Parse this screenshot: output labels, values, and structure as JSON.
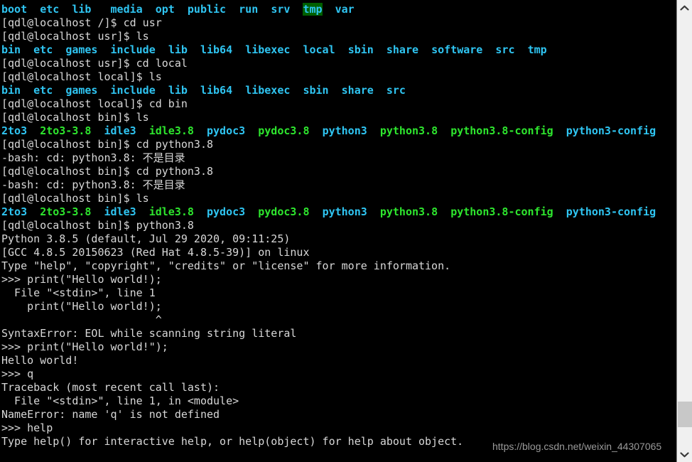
{
  "terminal": {
    "prompt_user_host": "[qdl@localhost",
    "lines": [
      {
        "id": "ls-root-output",
        "segments": [
          {
            "text": "boot",
            "style": "dir"
          },
          {
            "text": "  ",
            "style": "default"
          },
          {
            "text": "etc",
            "style": "dir"
          },
          {
            "text": "  ",
            "style": "default"
          },
          {
            "text": "lib",
            "style": "dir"
          },
          {
            "text": "   ",
            "style": "default"
          },
          {
            "text": "media",
            "style": "dir"
          },
          {
            "text": "  ",
            "style": "default"
          },
          {
            "text": "opt",
            "style": "dir"
          },
          {
            "text": "  ",
            "style": "default"
          },
          {
            "text": "public",
            "style": "dir"
          },
          {
            "text": "  ",
            "style": "default"
          },
          {
            "text": "run",
            "style": "dir"
          },
          {
            "text": "  ",
            "style": "default"
          },
          {
            "text": "srv",
            "style": "dir"
          },
          {
            "text": "  ",
            "style": "default"
          },
          {
            "text": "tmp",
            "style": "dir-sticky"
          },
          {
            "text": "  ",
            "style": "default"
          },
          {
            "text": "var",
            "style": "dir"
          }
        ]
      },
      {
        "id": "prompt-cd-usr",
        "segments": [
          {
            "text": "[qdl@localhost /]$ cd usr",
            "style": "default"
          }
        ]
      },
      {
        "id": "prompt-ls-usr",
        "segments": [
          {
            "text": "[qdl@localhost usr]$ ls",
            "style": "default"
          }
        ]
      },
      {
        "id": "ls-usr-output",
        "segments": [
          {
            "text": "bin",
            "style": "dir"
          },
          {
            "text": "  ",
            "style": "default"
          },
          {
            "text": "etc",
            "style": "dir"
          },
          {
            "text": "  ",
            "style": "default"
          },
          {
            "text": "games",
            "style": "dir"
          },
          {
            "text": "  ",
            "style": "default"
          },
          {
            "text": "include",
            "style": "dir"
          },
          {
            "text": "  ",
            "style": "default"
          },
          {
            "text": "lib",
            "style": "dir"
          },
          {
            "text": "  ",
            "style": "default"
          },
          {
            "text": "lib64",
            "style": "dir"
          },
          {
            "text": "  ",
            "style": "default"
          },
          {
            "text": "libexec",
            "style": "dir"
          },
          {
            "text": "  ",
            "style": "default"
          },
          {
            "text": "local",
            "style": "dir"
          },
          {
            "text": "  ",
            "style": "default"
          },
          {
            "text": "sbin",
            "style": "dir"
          },
          {
            "text": "  ",
            "style": "default"
          },
          {
            "text": "share",
            "style": "dir"
          },
          {
            "text": "  ",
            "style": "default"
          },
          {
            "text": "software",
            "style": "dir"
          },
          {
            "text": "  ",
            "style": "default"
          },
          {
            "text": "src",
            "style": "dir"
          },
          {
            "text": "  ",
            "style": "default"
          },
          {
            "text": "tmp",
            "style": "dir"
          }
        ]
      },
      {
        "id": "prompt-cd-local",
        "segments": [
          {
            "text": "[qdl@localhost usr]$ cd local",
            "style": "default"
          }
        ]
      },
      {
        "id": "prompt-ls-local",
        "segments": [
          {
            "text": "[qdl@localhost local]$ ls",
            "style": "default"
          }
        ]
      },
      {
        "id": "ls-local-output",
        "segments": [
          {
            "text": "bin",
            "style": "dir"
          },
          {
            "text": "  ",
            "style": "default"
          },
          {
            "text": "etc",
            "style": "dir"
          },
          {
            "text": "  ",
            "style": "default"
          },
          {
            "text": "games",
            "style": "dir"
          },
          {
            "text": "  ",
            "style": "default"
          },
          {
            "text": "include",
            "style": "dir"
          },
          {
            "text": "  ",
            "style": "default"
          },
          {
            "text": "lib",
            "style": "dir"
          },
          {
            "text": "  ",
            "style": "default"
          },
          {
            "text": "lib64",
            "style": "dir"
          },
          {
            "text": "  ",
            "style": "default"
          },
          {
            "text": "libexec",
            "style": "dir"
          },
          {
            "text": "  ",
            "style": "default"
          },
          {
            "text": "sbin",
            "style": "dir"
          },
          {
            "text": "  ",
            "style": "default"
          },
          {
            "text": "share",
            "style": "dir"
          },
          {
            "text": "  ",
            "style": "default"
          },
          {
            "text": "src",
            "style": "dir"
          }
        ]
      },
      {
        "id": "prompt-cd-bin",
        "segments": [
          {
            "text": "[qdl@localhost local]$ cd bin",
            "style": "default"
          }
        ]
      },
      {
        "id": "prompt-ls-bin-1",
        "segments": [
          {
            "text": "[qdl@localhost bin]$ ls",
            "style": "default"
          }
        ]
      },
      {
        "id": "ls-bin-output-1",
        "segments": [
          {
            "text": "2to3",
            "style": "dir"
          },
          {
            "text": "  ",
            "style": "default"
          },
          {
            "text": "2to3-3.8",
            "style": "exec"
          },
          {
            "text": "  ",
            "style": "default"
          },
          {
            "text": "idle3",
            "style": "dir"
          },
          {
            "text": "  ",
            "style": "default"
          },
          {
            "text": "idle3.8",
            "style": "exec"
          },
          {
            "text": "  ",
            "style": "default"
          },
          {
            "text": "pydoc3",
            "style": "dir"
          },
          {
            "text": "  ",
            "style": "default"
          },
          {
            "text": "pydoc3.8",
            "style": "exec"
          },
          {
            "text": "  ",
            "style": "default"
          },
          {
            "text": "python3",
            "style": "dir"
          },
          {
            "text": "  ",
            "style": "default"
          },
          {
            "text": "python3.8",
            "style": "exec"
          },
          {
            "text": "  ",
            "style": "default"
          },
          {
            "text": "python3.8-config",
            "style": "exec"
          },
          {
            "text": "  ",
            "style": "default"
          },
          {
            "text": "python3-config",
            "style": "dir"
          }
        ]
      },
      {
        "id": "prompt-cd-python38-1",
        "segments": [
          {
            "text": "[qdl@localhost bin]$ cd python3.8",
            "style": "default"
          }
        ]
      },
      {
        "id": "error-not-a-directory-1",
        "segments": [
          {
            "text": "-bash: cd: python3.8: 不是目录",
            "style": "default"
          }
        ]
      },
      {
        "id": "prompt-cd-python38-2",
        "segments": [
          {
            "text": "[qdl@localhost bin]$ cd python3.8",
            "style": "default"
          }
        ]
      },
      {
        "id": "error-not-a-directory-2",
        "segments": [
          {
            "text": "-bash: cd: python3.8: 不是目录",
            "style": "default"
          }
        ]
      },
      {
        "id": "prompt-ls-bin-2",
        "segments": [
          {
            "text": "[qdl@localhost bin]$ ls",
            "style": "default"
          }
        ]
      },
      {
        "id": "ls-bin-output-2",
        "segments": [
          {
            "text": "2to3",
            "style": "dir"
          },
          {
            "text": "  ",
            "style": "default"
          },
          {
            "text": "2to3-3.8",
            "style": "exec"
          },
          {
            "text": "  ",
            "style": "default"
          },
          {
            "text": "idle3",
            "style": "dir"
          },
          {
            "text": "  ",
            "style": "default"
          },
          {
            "text": "idle3.8",
            "style": "exec"
          },
          {
            "text": "  ",
            "style": "default"
          },
          {
            "text": "pydoc3",
            "style": "dir"
          },
          {
            "text": "  ",
            "style": "default"
          },
          {
            "text": "pydoc3.8",
            "style": "exec"
          },
          {
            "text": "  ",
            "style": "default"
          },
          {
            "text": "python3",
            "style": "dir"
          },
          {
            "text": "  ",
            "style": "default"
          },
          {
            "text": "python3.8",
            "style": "exec"
          },
          {
            "text": "  ",
            "style": "default"
          },
          {
            "text": "python3.8-config",
            "style": "exec"
          },
          {
            "text": "  ",
            "style": "default"
          },
          {
            "text": "python3-config",
            "style": "dir"
          }
        ]
      },
      {
        "id": "prompt-run-python38",
        "segments": [
          {
            "text": "[qdl@localhost bin]$ python3.8",
            "style": "default"
          }
        ]
      },
      {
        "id": "python-banner-version",
        "segments": [
          {
            "text": "Python 3.8.5 (default, Jul 29 2020, 09:11:25)",
            "style": "default"
          }
        ]
      },
      {
        "id": "python-banner-gcc",
        "segments": [
          {
            "text": "[GCC 4.8.5 20150623 (Red Hat 4.8.5-39)] on linux",
            "style": "default"
          }
        ]
      },
      {
        "id": "python-banner-help",
        "segments": [
          {
            "text": "Type \"help\", \"copyright\", \"credits\" or \"license\" for more information.",
            "style": "default"
          }
        ]
      },
      {
        "id": "py-input-print-bad",
        "segments": [
          {
            "text": ">>> print(\"Hello world!);",
            "style": "default"
          }
        ]
      },
      {
        "id": "py-traceback-file-1",
        "segments": [
          {
            "text": "  File \"<stdin>\", line 1",
            "style": "default"
          }
        ]
      },
      {
        "id": "py-traceback-source",
        "segments": [
          {
            "text": "    print(\"Hello world!);",
            "style": "default"
          }
        ]
      },
      {
        "id": "py-traceback-caret",
        "segments": [
          {
            "text": "                        ^",
            "style": "default"
          }
        ]
      },
      {
        "id": "py-syntax-error",
        "segments": [
          {
            "text": "SyntaxError: EOL while scanning string literal",
            "style": "default"
          }
        ]
      },
      {
        "id": "py-input-print-good",
        "segments": [
          {
            "text": ">>> print(\"Hello world!\");",
            "style": "default"
          }
        ]
      },
      {
        "id": "py-output-hello",
        "segments": [
          {
            "text": "Hello world!",
            "style": "default"
          }
        ]
      },
      {
        "id": "py-input-q",
        "segments": [
          {
            "text": ">>> q",
            "style": "default"
          }
        ]
      },
      {
        "id": "py-traceback-header",
        "segments": [
          {
            "text": "Traceback (most recent call last):",
            "style": "default"
          }
        ]
      },
      {
        "id": "py-traceback-file-2",
        "segments": [
          {
            "text": "  File \"<stdin>\", line 1, in <module>",
            "style": "default"
          }
        ]
      },
      {
        "id": "py-name-error",
        "segments": [
          {
            "text": "NameError: name 'q' is not defined",
            "style": "default"
          }
        ]
      },
      {
        "id": "py-input-help",
        "segments": [
          {
            "text": ">>> help",
            "style": "default"
          }
        ]
      },
      {
        "id": "py-output-help-hint",
        "segments": [
          {
            "text": "Type help() for interactive help, or help(object) for help about object.",
            "style": "default"
          }
        ]
      }
    ]
  },
  "scrollbar": {
    "up_arrow": "chevron-up",
    "down_arrow": "chevron-down"
  },
  "watermark": {
    "text": "https://blog.csdn.net/weixin_44307065"
  },
  "colors": {
    "background": "#000000",
    "foreground": "#d8d8d8",
    "directory": "#2fc5f2",
    "executable": "#2ee62e",
    "sticky_dir_bg": "#005f00",
    "scrollbar_track": "#f0f0f0",
    "scrollbar_thumb": "#c8c8c8",
    "watermark": "#9a9a9a"
  }
}
